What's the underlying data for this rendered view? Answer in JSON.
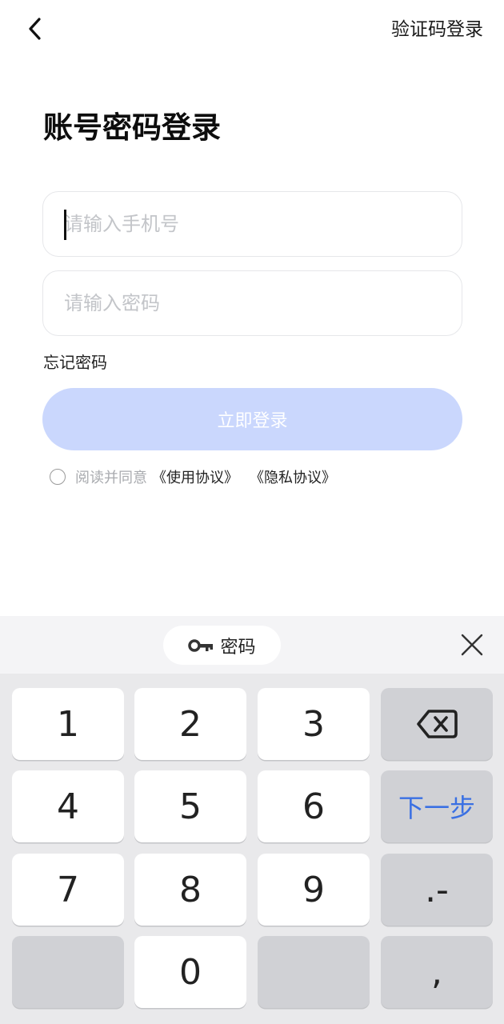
{
  "header": {
    "back_icon": "chevron-left-icon",
    "switch_link": "验证码登录"
  },
  "title": "账号密码登录",
  "form": {
    "phone_placeholder": "请输入手机号",
    "password_placeholder": "请输入密码",
    "forgot_password": "忘记密码",
    "login_button": "立即登录"
  },
  "agreement": {
    "prefix": "阅读并同意",
    "terms": "《使用协议》",
    "privacy": "《隐私协议》"
  },
  "keyboard": {
    "toolbar_label": "密码",
    "toolbar_icon": "key-icon",
    "close_icon": "close-icon",
    "keys": {
      "k1": "1",
      "k2": "2",
      "k3": "3",
      "k4": "4",
      "k5": "5",
      "k6": "6",
      "k7": "7",
      "k8": "8",
      "k9": "9",
      "k0": "0",
      "next": "下一步",
      "dot_minus": ".-",
      "comma": ","
    },
    "backspace_icon": "backspace-icon"
  },
  "colors": {
    "login_button_bg": "#cad7fd",
    "next_key_text": "#3a70e3",
    "keyboard_bg": "#e9e9eb",
    "function_key_bg": "#d0d1d5"
  }
}
